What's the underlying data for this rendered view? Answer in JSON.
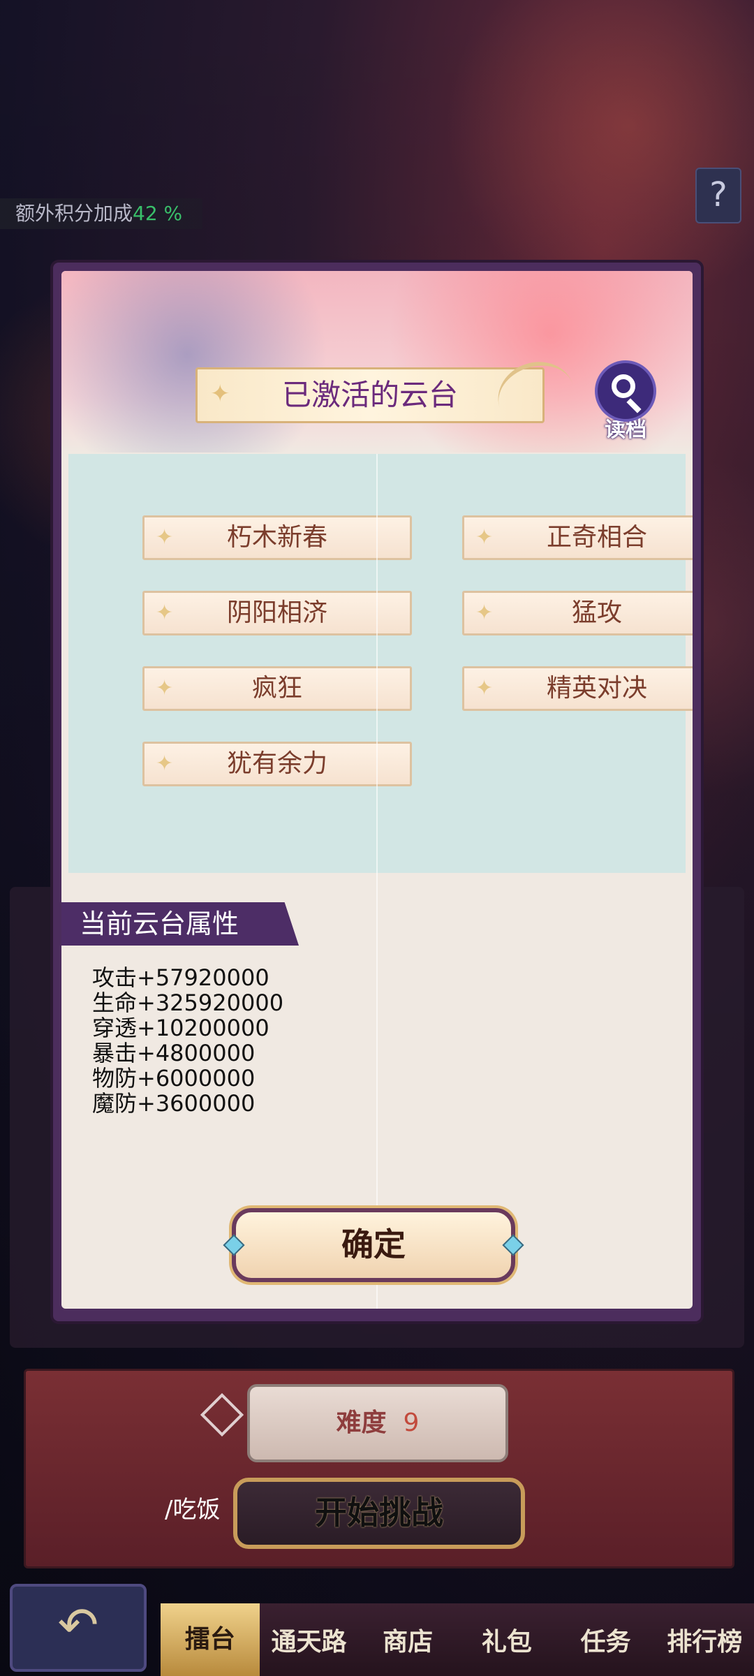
{
  "top": {
    "bonus_label": "额外积分加成",
    "bonus_value": "42 %",
    "help_label": "?"
  },
  "modal": {
    "title": "已激活的云台",
    "read_label": "读档",
    "tags": [
      "朽木新春",
      "正奇相合",
      "阴阳相济",
      "猛攻",
      "疯狂",
      "精英对决",
      "犹有余力"
    ],
    "attr_header": "当前云台属性",
    "attributes": [
      "攻击+57920000",
      "生命+325920000",
      "穿透+10200000",
      "暴击+4800000",
      "物防+6000000",
      "魔防+3600000"
    ],
    "confirm_label": "确定"
  },
  "background": {
    "difficulty_label": "难度",
    "difficulty_value": "9",
    "eat_label": "/吃饭",
    "start_label": "开始挑战"
  },
  "tabbar": {
    "tabs": [
      "擂台",
      "通天路",
      "商店",
      "礼包",
      "任务",
      "排行榜"
    ],
    "active_index": 0
  },
  "colors": {
    "modal_frame": "#4c2d5d",
    "accent_purple": "#6b2a7c",
    "tag_area": "#d2e6e4",
    "bonus_green": "#39c06a"
  }
}
